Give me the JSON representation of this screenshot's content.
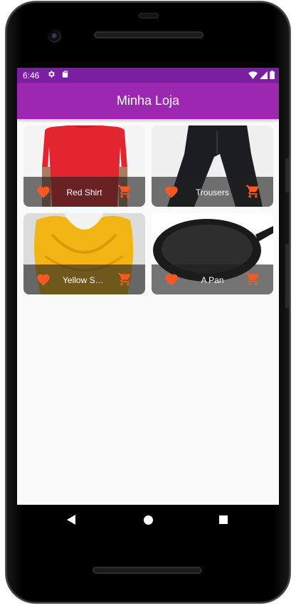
{
  "status_bar": {
    "time": "6:46",
    "icons": [
      "settings-icon",
      "sd-card-icon",
      "wifi-icon",
      "signal-icon",
      "battery-icon"
    ]
  },
  "app_bar": {
    "title": "Minha Loja"
  },
  "products": [
    {
      "title": "Red Shirt",
      "image": "red-shirt-image"
    },
    {
      "title": "Trousers",
      "image": "trousers-image"
    },
    {
      "title": "Yellow Scarf",
      "image": "yellow-scarf-image"
    },
    {
      "title": "A Pan",
      "image": "pan-image"
    }
  ],
  "colors": {
    "app_bar": "#9c27b0",
    "status_bar": "#7b1fa2",
    "accent": "#ff5722"
  },
  "nav_bar": {
    "icons": [
      "back-icon",
      "home-icon",
      "recents-icon"
    ]
  }
}
